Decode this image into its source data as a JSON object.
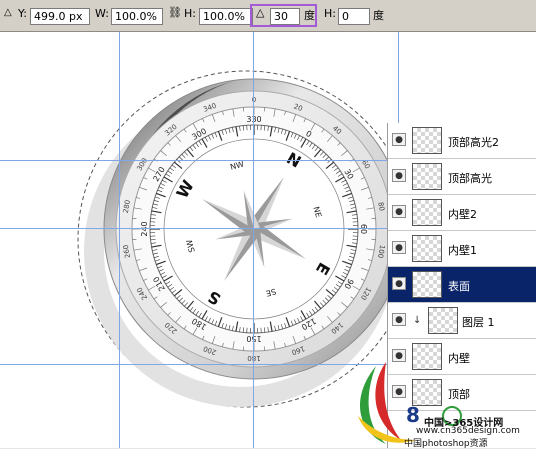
{
  "options_bar": {
    "y_label": "Y:",
    "y_value": "499.0 px",
    "w_label": "W:",
    "w_value": "100.0%",
    "h_label": "H:",
    "h_value": "100.0%",
    "angle_value": "30",
    "angle_unit": "度",
    "skew_h_label": "H:",
    "skew_h_value": "0",
    "skew_unit": "度"
  },
  "compass": {
    "cardinals": [
      "N",
      "E",
      "S",
      "W"
    ],
    "intercardinals": [
      "NE",
      "SE",
      "SW",
      "NW"
    ],
    "outer_degrees": [
      "340",
      "0",
      "20",
      "320",
      "300",
      "280",
      "260",
      "240",
      "220",
      "200",
      "180",
      "160",
      "140",
      "120",
      "100",
      "80",
      "60",
      "40"
    ],
    "inner_degrees": [
      "300",
      "330",
      "0",
      "30",
      "270",
      "240",
      "210",
      "180",
      "150",
      "120",
      "90",
      "60"
    ]
  },
  "layers": [
    {
      "name": "顶部高光2",
      "selected": false,
      "clipped": false
    },
    {
      "name": "顶部高光",
      "selected": false,
      "clipped": false
    },
    {
      "name": "内壁2",
      "selected": false,
      "clipped": false
    },
    {
      "name": "内壁1",
      "selected": false,
      "clipped": false
    },
    {
      "name": "表面",
      "selected": true,
      "clipped": false
    },
    {
      "name": "图层 1",
      "selected": false,
      "clipped": true
    },
    {
      "name": "内壁",
      "selected": false,
      "clipped": false
    },
    {
      "name": "顶部",
      "selected": false,
      "clipped": false
    }
  ],
  "watermark": {
    "line1": "中国>365设计网",
    "line2": "www.cn365design.com",
    "line3": "中国photoshop资源"
  },
  "colors": {
    "toolbar_bg": "#d4d0c8",
    "guide": "#7fa6e6",
    "selection": "#0a246a",
    "highlight_box": "#a25ad7"
  }
}
